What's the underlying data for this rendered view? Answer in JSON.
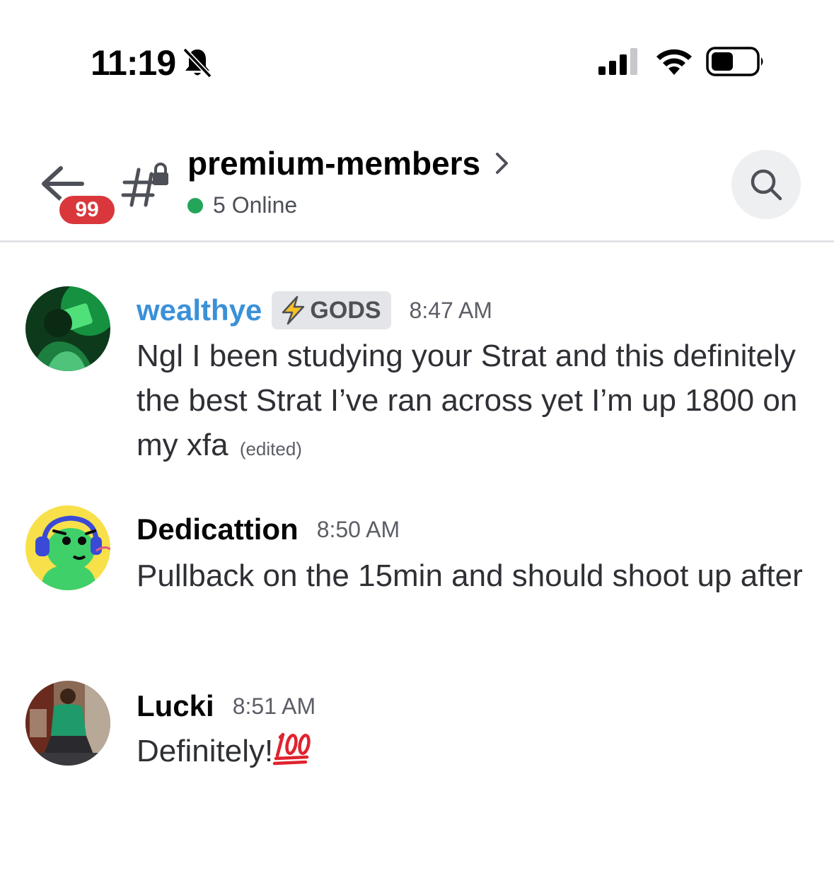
{
  "status_bar": {
    "time": "11:19"
  },
  "header": {
    "unread_badge": "99",
    "channel_name": "premium-members",
    "online_text": "5 Online"
  },
  "messages": [
    {
      "username": "wealthye",
      "role_tag": "GODS",
      "timestamp": "8:47 AM",
      "text": "Ngl I been studying your Strat and this definitely the best Strat I’ve ran across yet I’m up 1800 on my xfa",
      "edited_label": "(edited)"
    },
    {
      "username": "Dedicattion",
      "timestamp": "8:50 AM",
      "text": "Pullback on the 15min and should shoot up after"
    },
    {
      "username": "Lucki",
      "timestamp": "8:51 AM",
      "text": "Definitely!",
      "emoji": "hundred-points-emoji"
    }
  ],
  "colors": {
    "accent_blue": "#3b91d8",
    "online_green": "#23a55a",
    "badge_red": "#da373c"
  }
}
